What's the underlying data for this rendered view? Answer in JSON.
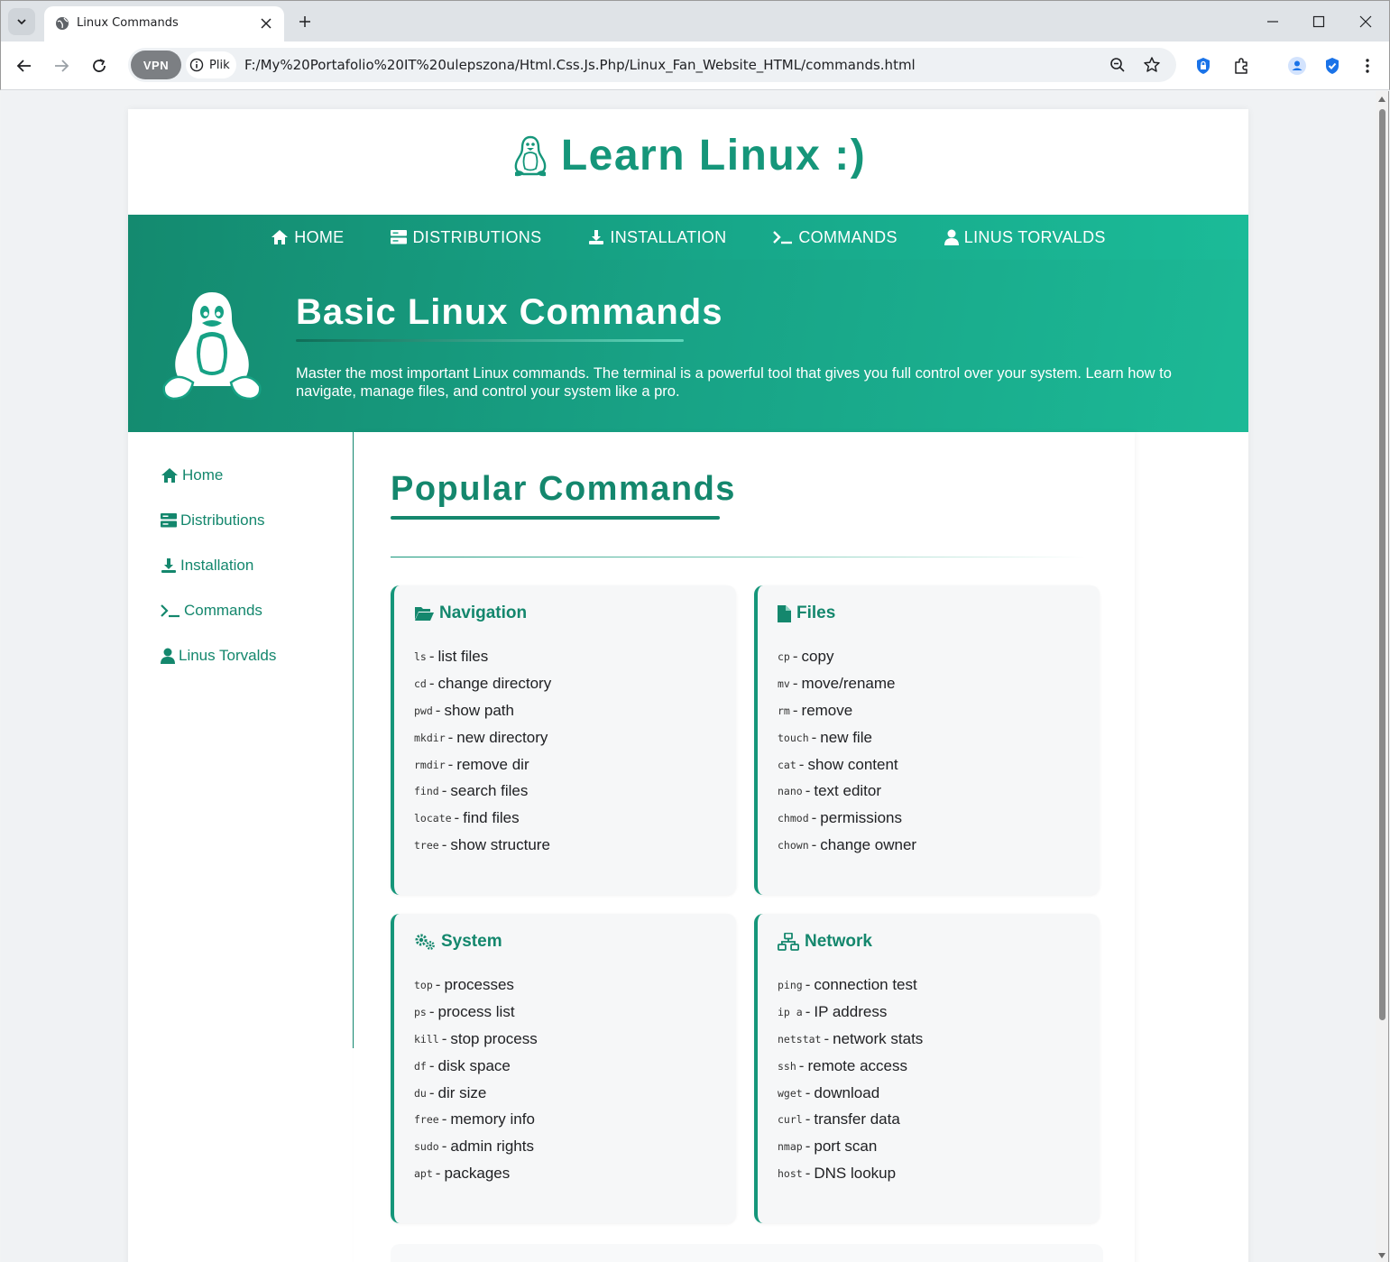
{
  "browser": {
    "tab_title": "Linux Commands",
    "vpn_label": "VPN",
    "site_info_label": "Plik",
    "url": "F:/My%20Portafolio%20IT%20ulepszona/Html.Css.Js.Php/Linux_Fan_Website_HTML/commands.html"
  },
  "site": {
    "logo_text": "Learn Linux :)",
    "nav": [
      {
        "label": "HOME",
        "icon": "home-icon"
      },
      {
        "label": "DISTRIBUTIONS",
        "icon": "server-icon"
      },
      {
        "label": "INSTALLATION",
        "icon": "download-icon"
      },
      {
        "label": "COMMANDS",
        "icon": "terminal-icon"
      },
      {
        "label": "LINUS TORVALDS",
        "icon": "user-icon"
      }
    ]
  },
  "hero": {
    "title": "Basic Linux Commands",
    "description": "Master the most important Linux commands. The terminal is a powerful tool that gives you full control over your system. Learn how to navigate, manage files, and control your system like a pro."
  },
  "sidebar": {
    "items": [
      {
        "label": "Home",
        "icon": "home-icon"
      },
      {
        "label": "Distributions",
        "icon": "server-icon"
      },
      {
        "label": "Installation",
        "icon": "download-icon"
      },
      {
        "label": "Commands",
        "icon": "terminal-icon"
      },
      {
        "label": "Linus Torvalds",
        "icon": "user-icon"
      }
    ]
  },
  "main": {
    "section_title": "Popular Commands",
    "cards": [
      {
        "title": "Navigation",
        "icon": "folder-open-icon",
        "commands": [
          {
            "cmd": "ls",
            "desc": "list files"
          },
          {
            "cmd": "cd",
            "desc": "change directory"
          },
          {
            "cmd": "pwd",
            "desc": "show path"
          },
          {
            "cmd": "mkdir",
            "desc": "new directory"
          },
          {
            "cmd": "rmdir",
            "desc": "remove dir"
          },
          {
            "cmd": "find",
            "desc": "search files"
          },
          {
            "cmd": "locate",
            "desc": "find files"
          },
          {
            "cmd": "tree",
            "desc": "show structure"
          }
        ]
      },
      {
        "title": "Files",
        "icon": "file-icon",
        "commands": [
          {
            "cmd": "cp",
            "desc": "copy"
          },
          {
            "cmd": "mv",
            "desc": "move/rename"
          },
          {
            "cmd": "rm",
            "desc": "remove"
          },
          {
            "cmd": "touch",
            "desc": "new file"
          },
          {
            "cmd": "cat",
            "desc": "show content"
          },
          {
            "cmd": "nano",
            "desc": "text editor"
          },
          {
            "cmd": "chmod",
            "desc": "permissions"
          },
          {
            "cmd": "chown",
            "desc": "change owner"
          }
        ]
      },
      {
        "title": "System",
        "icon": "cogs-icon",
        "commands": [
          {
            "cmd": "top",
            "desc": "processes"
          },
          {
            "cmd": "ps",
            "desc": "process list"
          },
          {
            "cmd": "kill",
            "desc": "stop process"
          },
          {
            "cmd": "df",
            "desc": "disk space"
          },
          {
            "cmd": "du",
            "desc": "dir size"
          },
          {
            "cmd": "free",
            "desc": "memory info"
          },
          {
            "cmd": "sudo",
            "desc": "admin rights"
          },
          {
            "cmd": "apt",
            "desc": "packages"
          }
        ]
      },
      {
        "title": "Network",
        "icon": "network-icon",
        "commands": [
          {
            "cmd": "ping",
            "desc": "connection test"
          },
          {
            "cmd": "ip a",
            "desc": "IP address"
          },
          {
            "cmd": "netstat",
            "desc": "network stats"
          },
          {
            "cmd": "ssh",
            "desc": "remote access"
          },
          {
            "cmd": "wget",
            "desc": "download"
          },
          {
            "cmd": "curl",
            "desc": "transfer data"
          },
          {
            "cmd": "nmap",
            "desc": "port scan"
          },
          {
            "cmd": "host",
            "desc": "DNS lookup"
          }
        ]
      }
    ]
  },
  "colors": {
    "accent": "#15967a",
    "accent_dark": "#14876d",
    "card_bg": "#f6f7f8"
  }
}
